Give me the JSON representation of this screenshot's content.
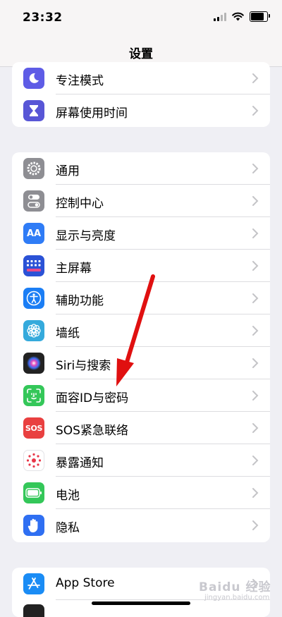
{
  "status": {
    "time": "23:32"
  },
  "nav": {
    "title": "设置"
  },
  "group1": [
    {
      "label": "专注模式",
      "icon": "moon-icon",
      "color": "#5e5ce6"
    },
    {
      "label": "屏幕使用时间",
      "icon": "hourglass-icon",
      "color": "#5856d6"
    }
  ],
  "group2": [
    {
      "label": "通用",
      "icon": "gear-icon",
      "color": "#8e8e93"
    },
    {
      "label": "控制中心",
      "icon": "toggles-icon",
      "color": "#8e8e93"
    },
    {
      "label": "显示与亮度",
      "icon": "aa-icon",
      "icon_text": "AA",
      "color": "#2f7cf6"
    },
    {
      "label": "主屏幕",
      "icon": "grid-icon",
      "color": "#2b52d6"
    },
    {
      "label": "辅助功能",
      "icon": "accessibility-icon",
      "color": "#1b7ef5"
    },
    {
      "label": "墙纸",
      "icon": "flower-icon",
      "color": "#35aadc"
    },
    {
      "label": "Siri与搜索",
      "icon": "siri-icon",
      "color": "#222222"
    },
    {
      "label": "面容ID与密码",
      "icon": "face-id-icon",
      "color": "#34c759"
    },
    {
      "label": "SOS紧急联络",
      "icon": "sos-icon",
      "icon_text": "SOS",
      "color": "#e94040"
    },
    {
      "label": "暴露通知",
      "icon": "exposure-icon",
      "color": "#ffffff"
    },
    {
      "label": "电池",
      "icon": "battery-icon",
      "color": "#34c759"
    },
    {
      "label": "隐私",
      "icon": "hand-icon",
      "color": "#2f6ff2"
    }
  ],
  "group3": [
    {
      "label": "App Store",
      "icon": "app-store-icon",
      "color": "#1a8cf5"
    }
  ],
  "watermark": {
    "text": "Baidu 经验",
    "sub": "jingyan.baidu.com"
  }
}
